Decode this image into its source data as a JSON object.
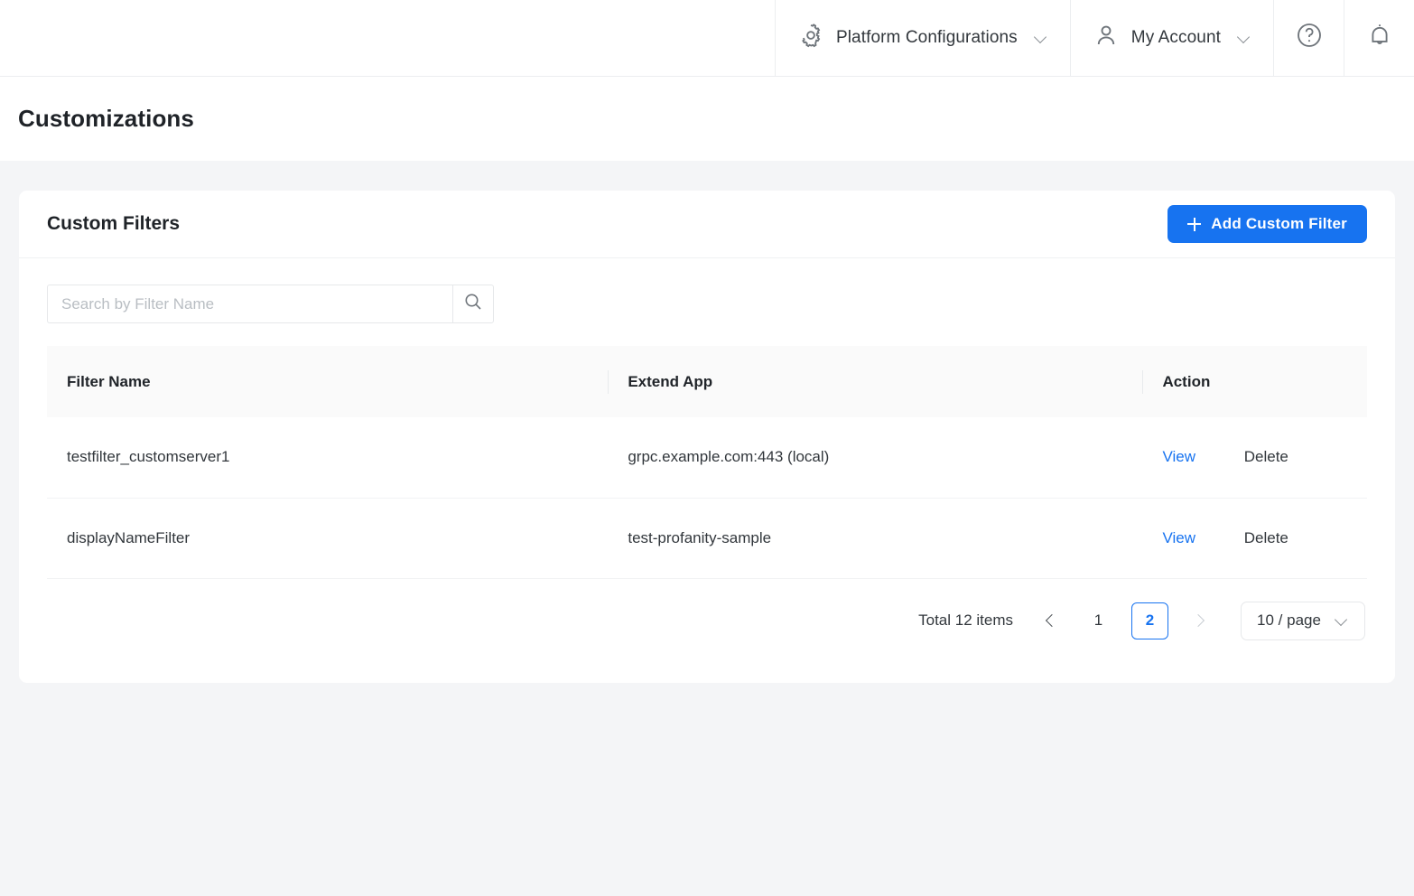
{
  "topbar": {
    "platform_config": {
      "label": "Platform Configurations",
      "icon": "gear-icon",
      "caret": "chevron-down-icon"
    },
    "account": {
      "label": "My Account",
      "icon": "user-icon",
      "caret": "chevron-down-icon"
    },
    "help": {
      "icon": "help-circle-icon"
    },
    "notifications": {
      "icon": "bell-icon"
    }
  },
  "page": {
    "title": "Customizations"
  },
  "card": {
    "title": "Custom Filters",
    "add_button": {
      "label": "Add Custom Filter",
      "icon": "plus-icon"
    },
    "search": {
      "placeholder": "Search by Filter Name",
      "value": "",
      "icon": "search-icon"
    },
    "table": {
      "columns": [
        "Filter Name",
        "Extend App",
        "Action"
      ],
      "rows": [
        {
          "filter_name": "testfilter_customserver1",
          "extend_app": "grpc.example.com:443 (local)",
          "view": "View",
          "delete": "Delete"
        },
        {
          "filter_name": "displayNameFilter",
          "extend_app": "test-profanity-sample",
          "view": "View",
          "delete": "Delete"
        }
      ]
    },
    "pagination": {
      "total": "Total 12 items",
      "prev": "chevron-left-icon",
      "pages": [
        "1",
        "2"
      ],
      "current_page": "2",
      "next": "chevron-right-icon",
      "page_size": "10 / page",
      "page_size_caret": "chevron-down-icon"
    }
  },
  "colors": {
    "accent": "#1773f0",
    "page_bg": "#f4f5f7",
    "card_bg": "#ffffff",
    "text": "#32373c",
    "muted": "#b9bec3"
  }
}
